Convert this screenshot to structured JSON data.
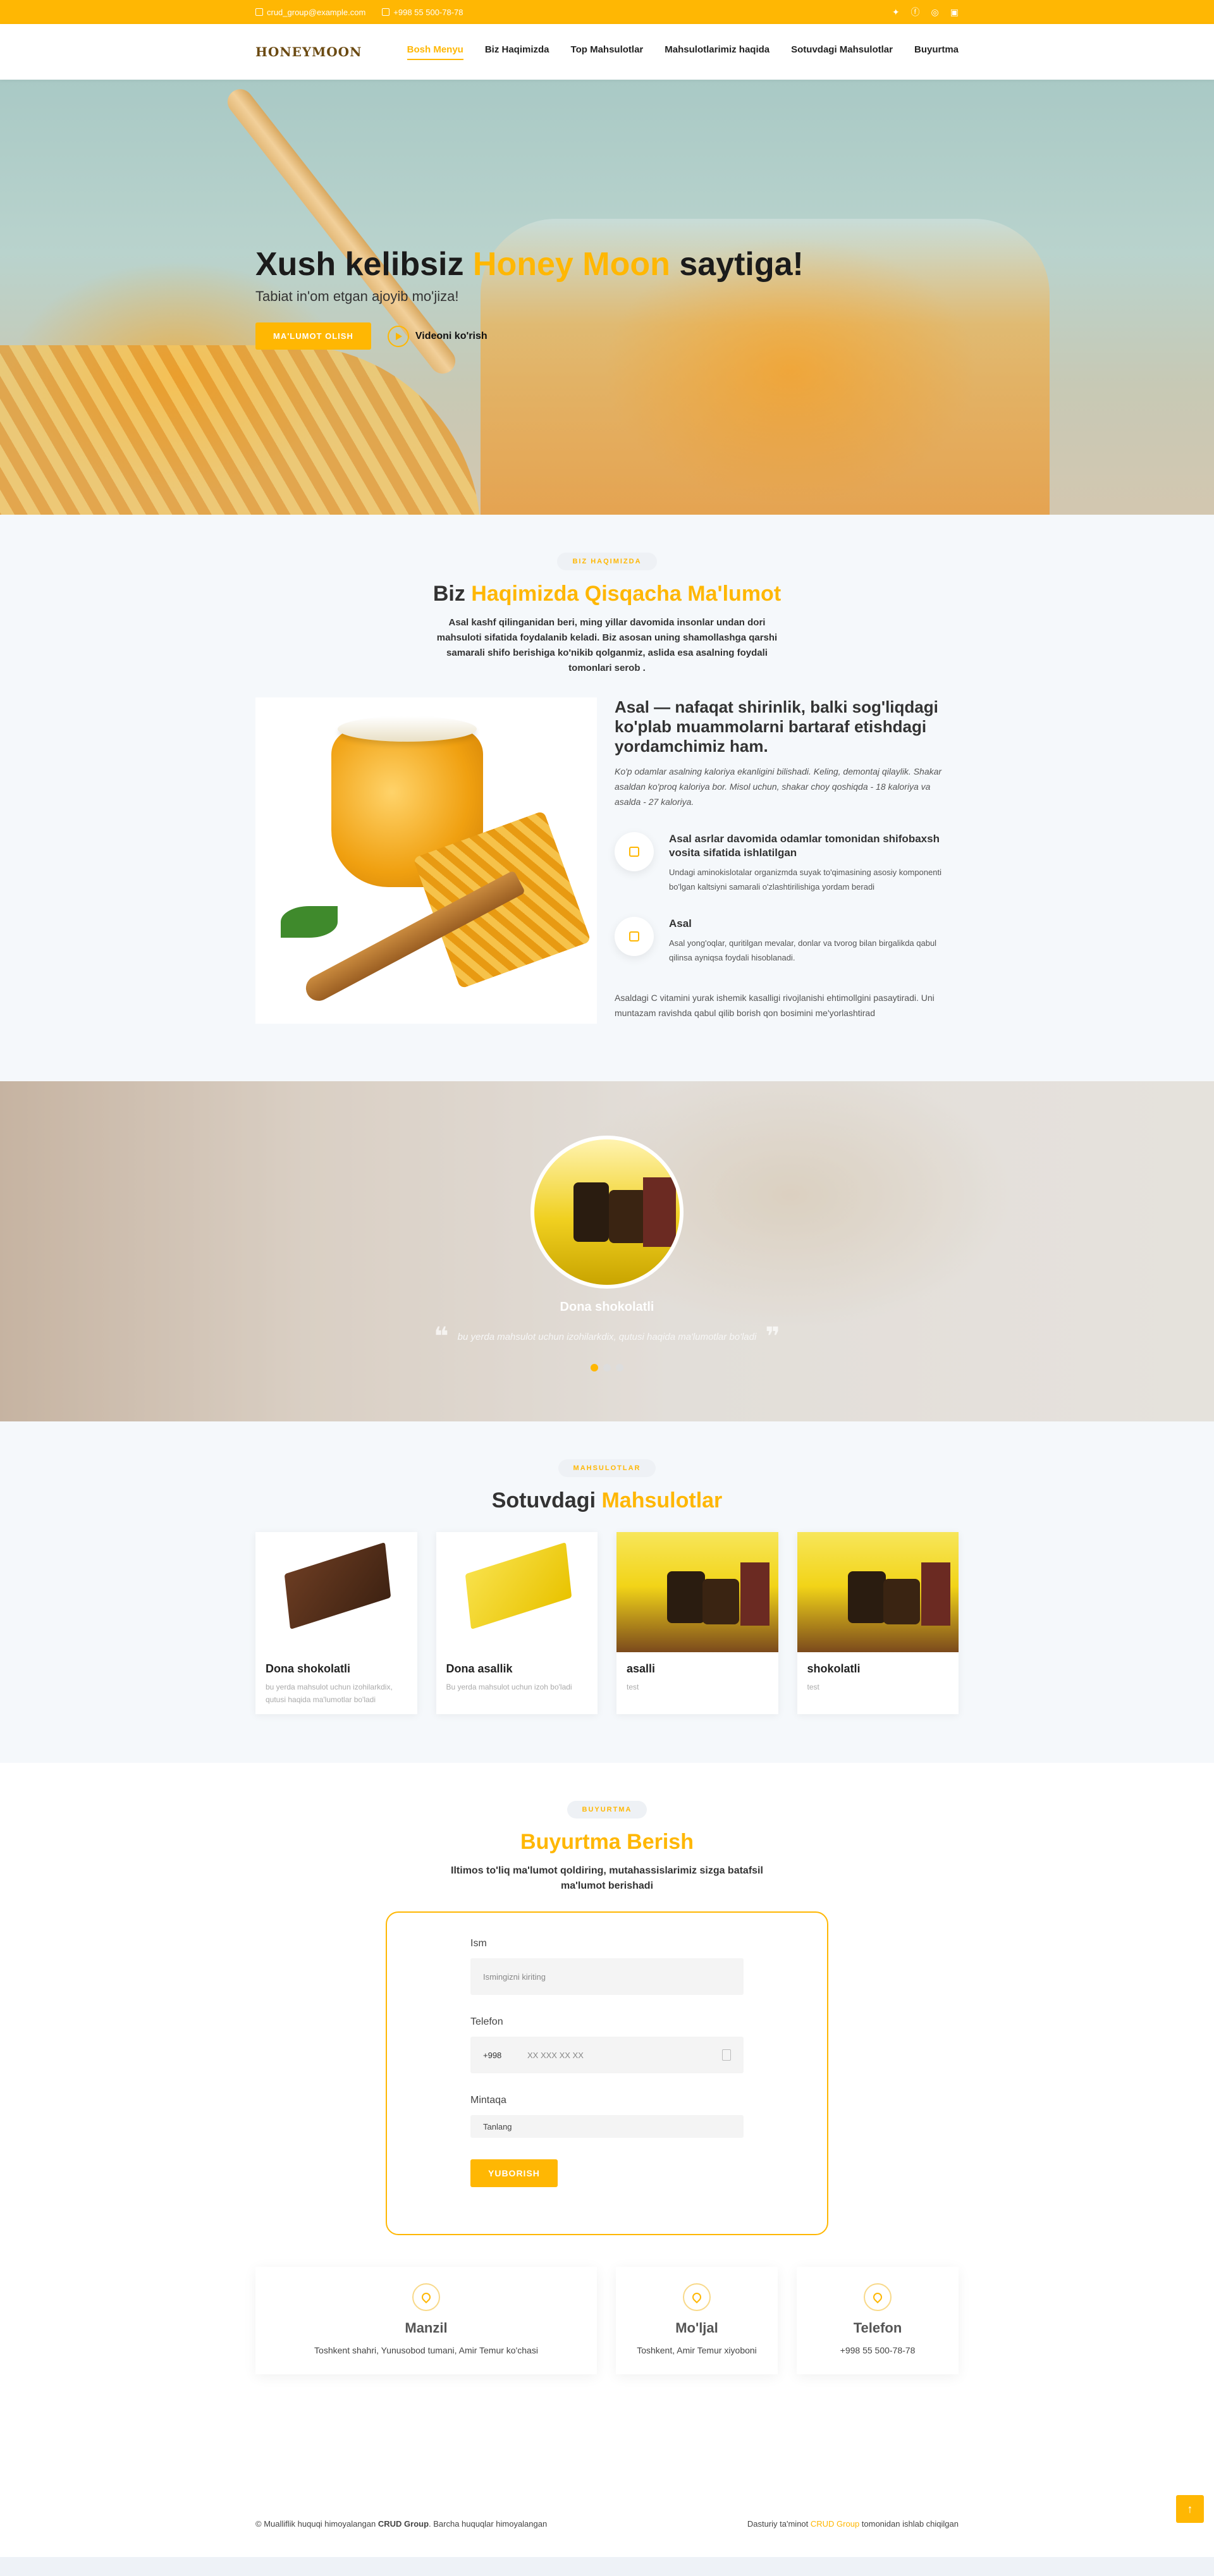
{
  "topbar": {
    "email": "crud_group@example.com",
    "phone": "+998 55 500-78-78",
    "social_icons": [
      "twitter-icon",
      "facebook-icon",
      "instagram-icon",
      "linkedin-icon"
    ]
  },
  "nav": {
    "logo": "HONEYMOON",
    "items": [
      {
        "label": "Bosh Menyu",
        "active": true
      },
      {
        "label": "Biz Haqimizda"
      },
      {
        "label": "Top Mahsulotlar"
      },
      {
        "label": "Mahsulotlarimiz haqida"
      },
      {
        "label": "Sotuvdagi Mahsulotlar"
      },
      {
        "label": "Buyurtma"
      }
    ]
  },
  "hero": {
    "title_before": "Xush kelibsiz ",
    "title_accent": "Honey Moon",
    "title_after": " saytiga!",
    "subtitle": "Tabiat in'om etgan ajoyib mo'jiza!",
    "cta": "MA'LUMOT OLISH",
    "video": "Videoni ko'rish"
  },
  "about": {
    "tag": "BIZ HAQIMIZDA",
    "title_before": "Biz ",
    "title_accent": "Haqimizda Qisqacha Ma'lumot",
    "intro": "Asal kashf qilinganidan beri, ming yillar davomida insonlar undan dori mahsuloti sifatida foydalanib keladi. Biz asosan uning shamollashga qarshi samarali shifo berishiga ko'nikib qolganmiz, aslida esa asalning foydali tomonlari serob .",
    "heading": "Asal — nafaqat shirinlik, balki sog'liqdagi ko'plab muammolarni bartaraf etishdagi yordamchimiz ham.",
    "italic": "Ko'p odamlar asalning kaloriya ekanligini bilishadi. Keling, demontaj qilaylik. Shakar asaldan ko'proq kaloriya bor. Misol uchun, shakar choy qoshiqda - 18 kaloriya va asalda - 27 kaloriya.",
    "features": [
      {
        "title": "Asal asrlar davomida odamlar tomonidan shifobaxsh vosita sifatida ishlatilgan",
        "text": "Undagi aminokislotalar organizmda suyak to'qimasining asosiy komponenti bo'lgan kaltsiyni samarali o'zlashtirilishiga yordam beradi"
      },
      {
        "title": "Asal",
        "text": "Asal yong'oqlar, quritilgan mevalar, donlar va tvorog bilan birgalikda qabul qilinsa ayniqsa foydali hisoblanadi."
      }
    ],
    "closing": "Asaldagi C vitamini yurak ishemik kasalligi rivojlanishi ehtimollgini pasaytiradi. Uni muntazam ravishda qabul qilib borish qon bosimini me'yorlashtirad"
  },
  "testimonial": {
    "name": "Dona shokolatli",
    "quote": "bu yerda mahsulot uchun izohilarkdix, qutusi haqida ma'lumotlar bo'ladi",
    "active_dot": 0,
    "dot_count": 3
  },
  "products": {
    "tag": "MAHSULOTLAR",
    "title_before": "Sotuvdagi ",
    "title_accent": "Mahsulotlar",
    "items": [
      {
        "name": "Dona shokolatli",
        "desc": "bu yerda mahsulot uchun izohilarkdix, qutusi haqida ma'lumotlar bo'ladi"
      },
      {
        "name": "Dona asallik",
        "desc": "Bu yerda mahsulot uchun izoh bo'ladi"
      },
      {
        "name": "asalli",
        "desc": "test"
      },
      {
        "name": "shokolatli",
        "desc": "test"
      }
    ]
  },
  "order": {
    "tag": "BUYURTMA",
    "title": "Buyurtma Berish",
    "intro": "Iltimos to'liq ma'lumot qoldiring, mutahassislarimiz sizga batafsil ma'lumot berishadi",
    "name_label": "Ism",
    "name_placeholder": "Ismingizni kiriting",
    "phone_label": "Telefon",
    "phone_code": "+998",
    "phone_placeholder": "XX XXX XX XX",
    "region_label": "Mintaqa",
    "region_value": "Tanlang",
    "submit": "YUBORISH"
  },
  "contacts": [
    {
      "title": "Manzil",
      "text": "Toshkent shahri, Yunusobod tumani, Amir Temur ko'chasi",
      "icon": "location-icon"
    },
    {
      "title": "Mo'ljal",
      "text": "Toshkent, Amir Temur xiyoboni",
      "icon": "mail-icon"
    },
    {
      "title": "Telefon",
      "text": "+998 55 500-78-78",
      "icon": "phone-icon"
    }
  ],
  "footer": {
    "left_before": "© Mualliflik huquqi himoyalangan ",
    "left_brand": "CRUD Group",
    "left_after": ". Barcha huquqlar himoyalangan",
    "right_before": "Dasturiy ta'minot ",
    "right_brand": "CRUD Group",
    "right_after": " tomonidan ishlab chiqilgan"
  },
  "colors": {
    "accent": "#ffb703",
    "text": "#333333",
    "section_bg": "#f5f8fb"
  }
}
